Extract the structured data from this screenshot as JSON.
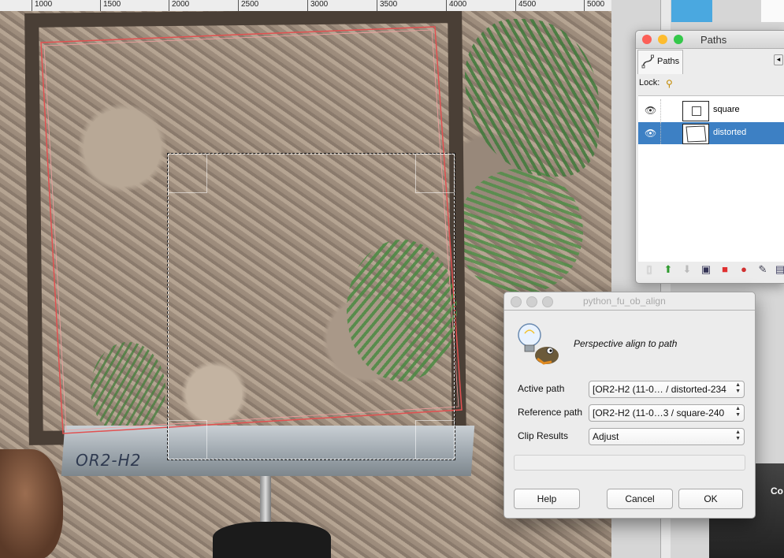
{
  "ruler": {
    "ticks": [
      "1000",
      "1500",
      "2000",
      "2500",
      "3000",
      "3500",
      "4000",
      "4500",
      "5000"
    ]
  },
  "canvas": {
    "plot_label": "OR2-H2"
  },
  "paths_dock": {
    "title": "Paths",
    "tab_label": "Paths",
    "lock_label": "Lock:",
    "menu_glyph": "◂",
    "paths": [
      {
        "name": "square",
        "visible_glyph": "👁",
        "selected": false
      },
      {
        "name": "distorted",
        "visible_glyph": "👁",
        "selected": true
      }
    ],
    "toolbar_icons": [
      "new-path-icon",
      "raise-path-icon",
      "lower-path-icon",
      "duplicate-path-icon",
      "path-to-selection-icon",
      "selection-to-path-icon",
      "paint-along-path-icon",
      "delete-path-icon"
    ]
  },
  "dialog": {
    "title": "python_fu_ob_align",
    "heading": "Perspective align to path",
    "fields": {
      "active_path_label": "Active path",
      "active_path_value": "[OR2-H2 (11-0… / distorted-234",
      "reference_path_label": "Reference path",
      "reference_path_value": "[OR2-H2 (11-0…3 / square-240",
      "clip_label": "Clip Results",
      "clip_value": "Adjust"
    },
    "buttons": {
      "help": "Help",
      "cancel": "Cancel",
      "ok": "OK"
    }
  },
  "background_window": {
    "partial_text": "Co"
  },
  "colors": {
    "selection_blue": "#3d80c4",
    "path_red": "#e25050",
    "traffic_red": "#fc5f57",
    "traffic_yellow": "#fdbc2e",
    "traffic_green": "#34c84a"
  }
}
